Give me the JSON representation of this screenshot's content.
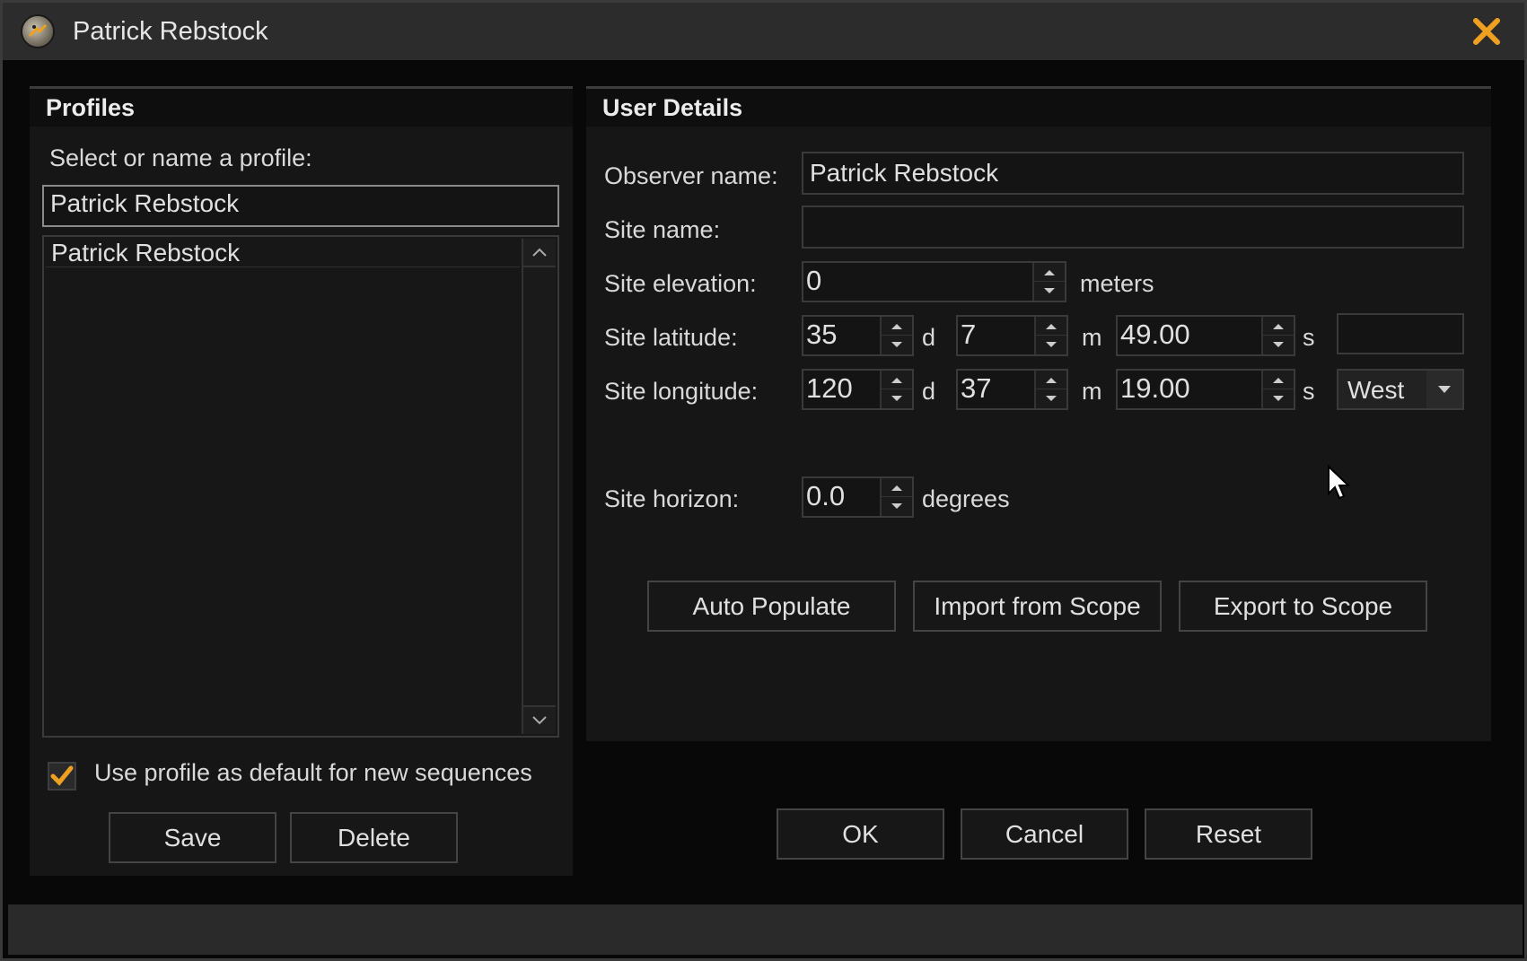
{
  "window": {
    "title": "Patrick Rebstock",
    "app_icon": "app-logo-icon",
    "close_icon": "close-icon",
    "accent_color": "#f0a020"
  },
  "profiles": {
    "header": "Profiles",
    "prompt": "Select or name a profile:",
    "name_input_value": "Patrick Rebstock",
    "list_items": [
      "Patrick Rebstock"
    ],
    "default_checkbox": {
      "label": "Use profile as default for new sequences",
      "checked": true
    },
    "save_label": "Save",
    "delete_label": "Delete"
  },
  "user_details": {
    "header": "User Details",
    "observer_label": "Observer name:",
    "observer_value": "Patrick Rebstock",
    "site_name_label": "Site name:",
    "site_name_value": "",
    "elevation_label": "Site elevation:",
    "elevation_value": "0",
    "elevation_unit": "meters",
    "latitude_label": "Site latitude:",
    "latitude": {
      "deg": "35",
      "d_unit": "d",
      "min": "7",
      "m_unit": "m",
      "sec": "49.00",
      "s_unit": "s",
      "hemisphere": ""
    },
    "longitude_label": "Site longitude:",
    "longitude": {
      "deg": "120",
      "d_unit": "d",
      "min": "37",
      "m_unit": "m",
      "sec": "19.00",
      "s_unit": "s",
      "hemisphere": "West"
    },
    "horizon_label": "Site horizon:",
    "horizon_value": "0.0",
    "horizon_unit": "degrees",
    "auto_populate_label": "Auto Populate",
    "import_label": "Import from Scope",
    "export_label": "Export to Scope"
  },
  "footer": {
    "ok_label": "OK",
    "cancel_label": "Cancel",
    "reset_label": "Reset"
  }
}
